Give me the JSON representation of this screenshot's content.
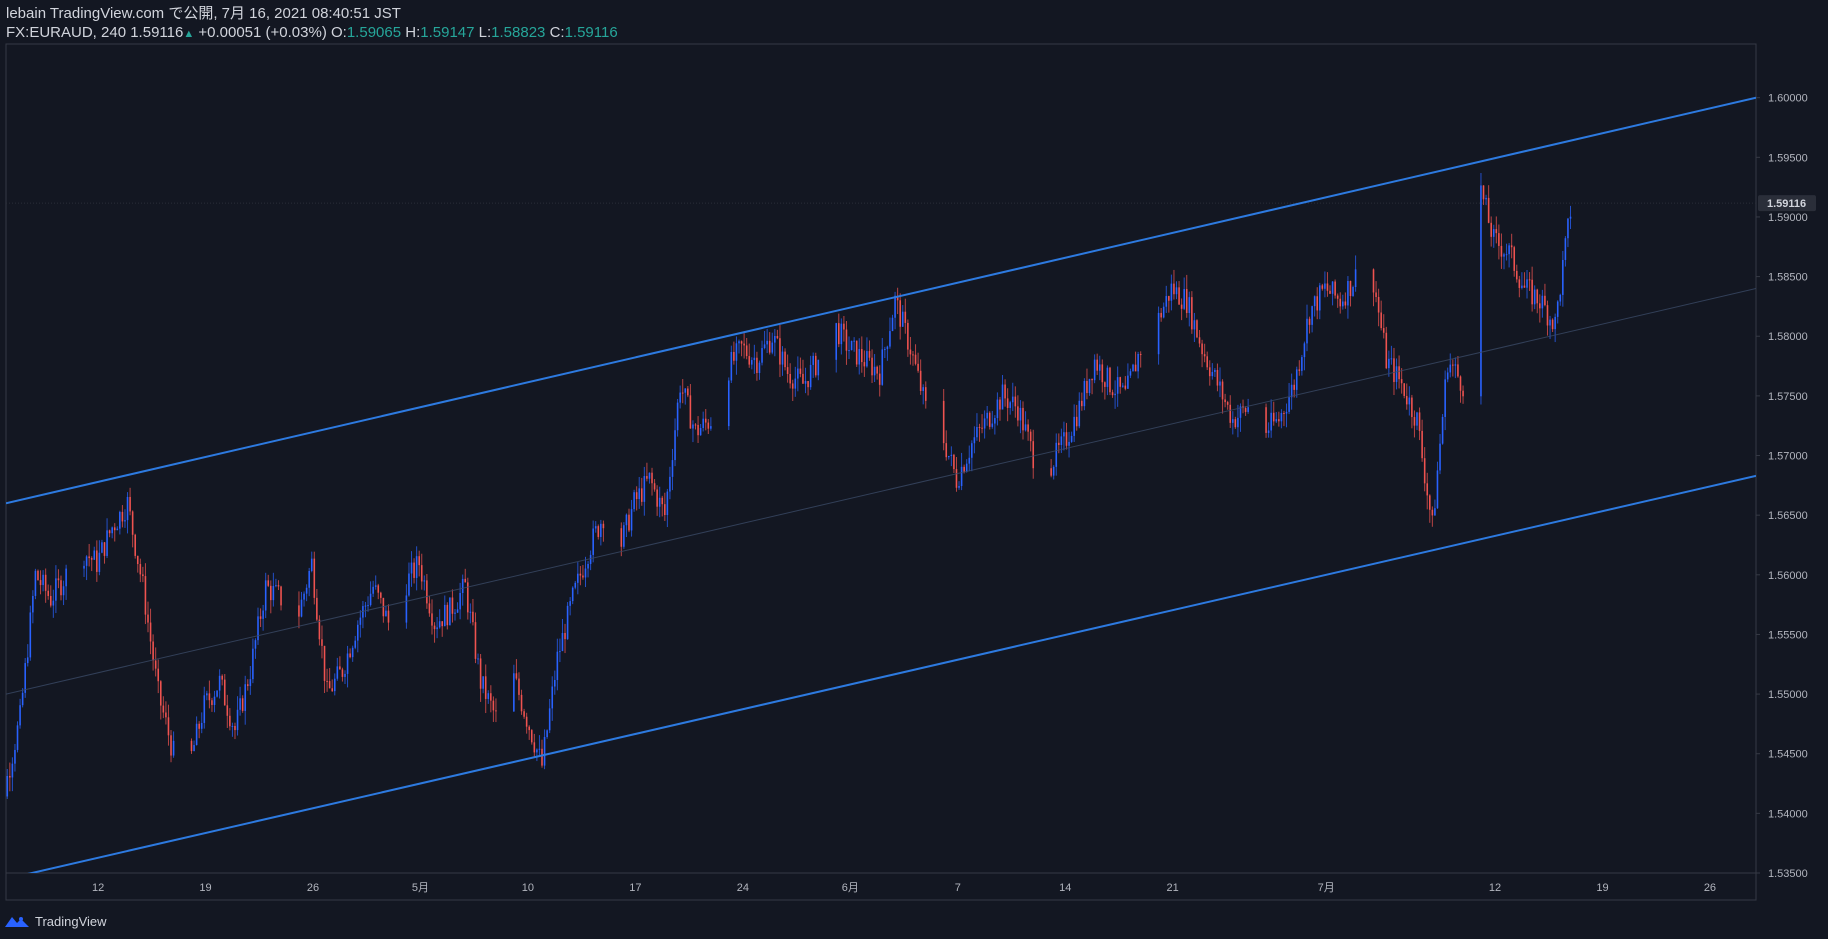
{
  "header": {
    "publish": "lebain TradingView.com で公開, 7月 16, 2021 08:40:51 JST",
    "symbol": "FX:EURAUD, 240",
    "last": "1.59116",
    "change": "+0.00051 (+0.03%)",
    "o_label": "O:",
    "o_value": "1.59065",
    "h_label": "H:",
    "h_value": "1.59147",
    "l_label": "L:",
    "l_value": "1.58823",
    "c_label": "C:",
    "c_value": "1.59116"
  },
  "footer": {
    "brand": "TradingView"
  },
  "colors": {
    "background": "#131722",
    "up": "#2962ff",
    "down": "#ef5350",
    "channel": "#2d7ae0",
    "text": "#b2b5be",
    "border": "#363a45"
  },
  "chart_data": {
    "type": "candlestick",
    "symbol": "FX:EURAUD",
    "timeframe": "240",
    "ylim": [
      1.535,
      1.6045
    ],
    "xlim": [
      "2021-04-06",
      "2021-07-29"
    ],
    "y_ticks": [
      "1.60000",
      "1.59500",
      "1.59000",
      "1.58500",
      "1.58000",
      "1.57500",
      "1.57000",
      "1.56500",
      "1.56000",
      "1.55500",
      "1.55000",
      "1.54500",
      "1.54000",
      "1.53500"
    ],
    "x_ticks": [
      {
        "label": "12",
        "date": "2021-04-12"
      },
      {
        "label": "19",
        "date": "2021-04-19"
      },
      {
        "label": "26",
        "date": "2021-04-26"
      },
      {
        "label": "5月",
        "date": "2021-05-03"
      },
      {
        "label": "10",
        "date": "2021-05-10"
      },
      {
        "label": "17",
        "date": "2021-05-17"
      },
      {
        "label": "24",
        "date": "2021-05-24"
      },
      {
        "label": "6月",
        "date": "2021-05-31"
      },
      {
        "label": "7",
        "date": "2021-06-07"
      },
      {
        "label": "14",
        "date": "2021-06-14"
      },
      {
        "label": "21",
        "date": "2021-06-21"
      },
      {
        "label": "7月",
        "date": "2021-07-01"
      },
      {
        "label": "12",
        "date": "2021-07-12"
      },
      {
        "label": "19",
        "date": "2021-07-19"
      },
      {
        "label": "26",
        "date": "2021-07-26"
      }
    ],
    "last_price": "1.59116",
    "price_path": [
      [
        "2021-04-05",
        1.545
      ],
      [
        "2021-04-06",
        1.542
      ],
      [
        "2021-04-07",
        1.548
      ],
      [
        "2021-04-08",
        1.56
      ],
      [
        "2021-04-09",
        1.558
      ],
      [
        "2021-04-11",
        1.562
      ],
      [
        "2021-04-12",
        1.561
      ],
      [
        "2021-04-13",
        1.564
      ],
      [
        "2021-04-14",
        1.566
      ],
      [
        "2021-04-15",
        1.559
      ],
      [
        "2021-04-16",
        1.55
      ],
      [
        "2021-04-17",
        1.545
      ],
      [
        "2021-04-18",
        1.544
      ],
      [
        "2021-04-19",
        1.549
      ],
      [
        "2021-04-20",
        1.551
      ],
      [
        "2021-04-21",
        1.547
      ],
      [
        "2021-04-22",
        1.552
      ],
      [
        "2021-04-23",
        1.559
      ],
      [
        "2021-04-24",
        1.558
      ],
      [
        "2021-04-25",
        1.556
      ],
      [
        "2021-04-26",
        1.561
      ],
      [
        "2021-04-27",
        1.55
      ],
      [
        "2021-04-28",
        1.552
      ],
      [
        "2021-04-29",
        1.556
      ],
      [
        "2021-04-30",
        1.559
      ],
      [
        "2021-05-01",
        1.556
      ],
      [
        "2021-05-02",
        1.559
      ],
      [
        "2021-05-03",
        1.561
      ],
      [
        "2021-05-04",
        1.556
      ],
      [
        "2021-05-05",
        1.557
      ],
      [
        "2021-05-06",
        1.559
      ],
      [
        "2021-05-07",
        1.551
      ],
      [
        "2021-05-08",
        1.548
      ],
      [
        "2021-05-09",
        1.552
      ],
      [
        "2021-05-10",
        1.548
      ],
      [
        "2021-05-11",
        1.544
      ],
      [
        "2021-05-12",
        1.553
      ],
      [
        "2021-05-13",
        1.558
      ],
      [
        "2021-05-14",
        1.562
      ],
      [
        "2021-05-15",
        1.565
      ],
      [
        "2021-05-16",
        1.562
      ],
      [
        "2021-05-17",
        1.566
      ],
      [
        "2021-05-18",
        1.568
      ],
      [
        "2021-05-19",
        1.565
      ],
      [
        "2021-05-20",
        1.576
      ],
      [
        "2021-05-21",
        1.572
      ],
      [
        "2021-05-22",
        1.573
      ],
      [
        "2021-05-23",
        1.577
      ],
      [
        "2021-05-24",
        1.579
      ],
      [
        "2021-05-25",
        1.578
      ],
      [
        "2021-05-26",
        1.58
      ],
      [
        "2021-05-27",
        1.577
      ],
      [
        "2021-05-28",
        1.576
      ],
      [
        "2021-05-29",
        1.578
      ],
      [
        "2021-05-30",
        1.581
      ],
      [
        "2021-05-31",
        1.579
      ],
      [
        "2021-06-01",
        1.578
      ],
      [
        "2021-06-02",
        1.577
      ],
      [
        "2021-06-03",
        1.583
      ],
      [
        "2021-06-04",
        1.579
      ],
      [
        "2021-06-05",
        1.574
      ],
      [
        "2021-06-06",
        1.572
      ],
      [
        "2021-06-07",
        1.568
      ],
      [
        "2021-06-08",
        1.571
      ],
      [
        "2021-06-09",
        1.573
      ],
      [
        "2021-06-10",
        1.575
      ],
      [
        "2021-06-11",
        1.574
      ],
      [
        "2021-06-12",
        1.57
      ],
      [
        "2021-06-13",
        1.569
      ],
      [
        "2021-06-14",
        1.571
      ],
      [
        "2021-06-15",
        1.574
      ],
      [
        "2021-06-16",
        1.578
      ],
      [
        "2021-06-17",
        1.576
      ],
      [
        "2021-06-18",
        1.575
      ],
      [
        "2021-06-19",
        1.579
      ],
      [
        "2021-06-20",
        1.581
      ],
      [
        "2021-06-21",
        1.584
      ],
      [
        "2021-06-22",
        1.583
      ],
      [
        "2021-06-23",
        1.579
      ],
      [
        "2021-06-24",
        1.576
      ],
      [
        "2021-06-25",
        1.573
      ],
      [
        "2021-06-26",
        1.574
      ],
      [
        "2021-06-27",
        1.572
      ],
      [
        "2021-06-28",
        1.573
      ],
      [
        "2021-06-29",
        1.576
      ],
      [
        "2021-06-30",
        1.582
      ],
      [
        "2021-07-01",
        1.584
      ],
      [
        "2021-07-02",
        1.583
      ],
      [
        "2021-07-03",
        1.585
      ],
      [
        "2021-07-04",
        1.586
      ],
      [
        "2021-07-05",
        1.578
      ],
      [
        "2021-07-06",
        1.576
      ],
      [
        "2021-07-07",
        1.573
      ],
      [
        "2021-07-08",
        1.564
      ],
      [
        "2021-07-09",
        1.578
      ],
      [
        "2021-07-10",
        1.576
      ],
      [
        "2021-07-11",
        1.593
      ],
      [
        "2021-07-12",
        1.588
      ],
      [
        "2021-07-13",
        1.587
      ],
      [
        "2021-07-14",
        1.584
      ],
      [
        "2021-07-15",
        1.583
      ],
      [
        "2021-07-16",
        1.581
      ],
      [
        "2021-07-17",
        1.5905
      ]
    ],
    "channel_upper": [
      [
        "2021-04-06",
        1.566
      ],
      [
        "2021-07-29",
        1.6
      ]
    ],
    "channel_lower": [
      [
        "2021-04-06",
        1.5345
      ],
      [
        "2021-07-29",
        1.5683
      ]
    ],
    "channel_mid": [
      [
        "2021-04-06",
        1.55
      ],
      [
        "2021-07-29",
        1.584
      ]
    ]
  }
}
